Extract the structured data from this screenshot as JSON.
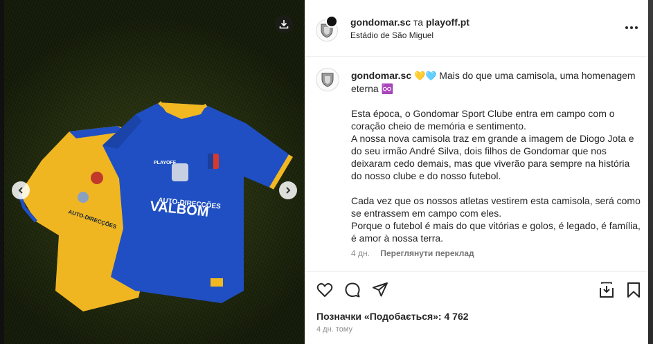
{
  "header": {
    "author": "gondomar.sc",
    "separator": "та",
    "collaborator": "playoff.pt",
    "location": "Estádio de São Miguel"
  },
  "caption": {
    "author": "gondomar.sc",
    "hearts": "💛🩵",
    "line1": " Mais do que uma camisola, uma homenagem eterna ♾️",
    "body": "\n\nEsta época, o Gondomar Sport Clube entra em campo com o coração cheio de memória e sentimento.\nA nossa nova camisola traz em grande a imagem de Diogo Jota e do seu irmão André Silva, dois filhos de Gondomar que nos deixaram cedo demais, mas que viverão para sempre na história do nosso clube e do nosso futebol.\n\nCada vez que os nossos atletas vestirem esta camisola, será como se entrassem em campo com eles.\nPorque o futebol é mais do que vitórias e golos, é legado, é família, é amor à nossa terra.",
    "age": "4 дн.",
    "translate": "Переглянути переклад"
  },
  "media": {
    "shirt_text_top": "AUTO-DIRECÇÕES",
    "shirt_text_brand": "VALBOM",
    "shirt_maker": "PLAYOFF",
    "colors": {
      "blue": "#1f4fc2",
      "yellow": "#f2b821",
      "grass": "#2f3a14"
    }
  },
  "footer": {
    "likes": "Позначки «Подобається»: 4 762",
    "date": "4 дн. тому"
  },
  "icons": [
    "download-icon",
    "chevron-left-icon",
    "chevron-right-icon",
    "more-icon",
    "heart-icon",
    "comment-icon",
    "share-icon",
    "save-to-collection-icon",
    "bookmark-icon"
  ]
}
